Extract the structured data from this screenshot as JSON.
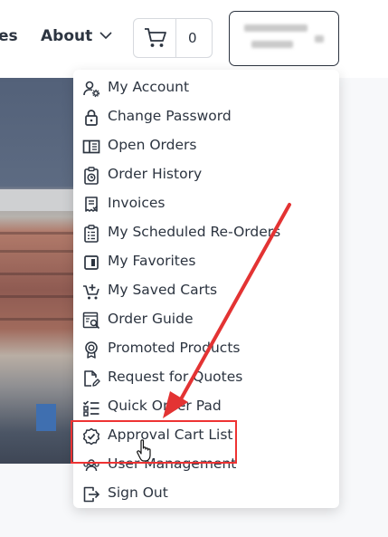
{
  "nav": {
    "prev_partial": "es",
    "about_label": "About",
    "cart_count": "0"
  },
  "menu": {
    "items": [
      {
        "label": "My Account",
        "icon": "user-gear-icon"
      },
      {
        "label": "Change Password",
        "icon": "lock-icon"
      },
      {
        "label": "Open Orders",
        "icon": "open-book-icon"
      },
      {
        "label": "Order History",
        "icon": "clipboard-clock-icon"
      },
      {
        "label": "Invoices",
        "icon": "receipt-icon"
      },
      {
        "label": "My Scheduled Re-Orders",
        "icon": "clipboard-list-icon"
      },
      {
        "label": "My Favorites",
        "icon": "bookmark-square-icon"
      },
      {
        "label": "My Saved Carts",
        "icon": "cart-plus-icon"
      },
      {
        "label": "Order Guide",
        "icon": "guide-search-icon"
      },
      {
        "label": "Promoted Products",
        "icon": "badge-icon"
      },
      {
        "label": "Request for Quotes",
        "icon": "document-edit-icon"
      },
      {
        "label": "Quick Order Pad",
        "icon": "checklist-icon"
      },
      {
        "label": "Approval Cart List",
        "icon": "check-badge-icon"
      },
      {
        "label": "User Management",
        "icon": "users-icon"
      },
      {
        "label": "Sign Out",
        "icon": "sign-out-icon"
      }
    ]
  },
  "colors": {
    "text": "#2c3440",
    "annotation": "#e33333"
  }
}
